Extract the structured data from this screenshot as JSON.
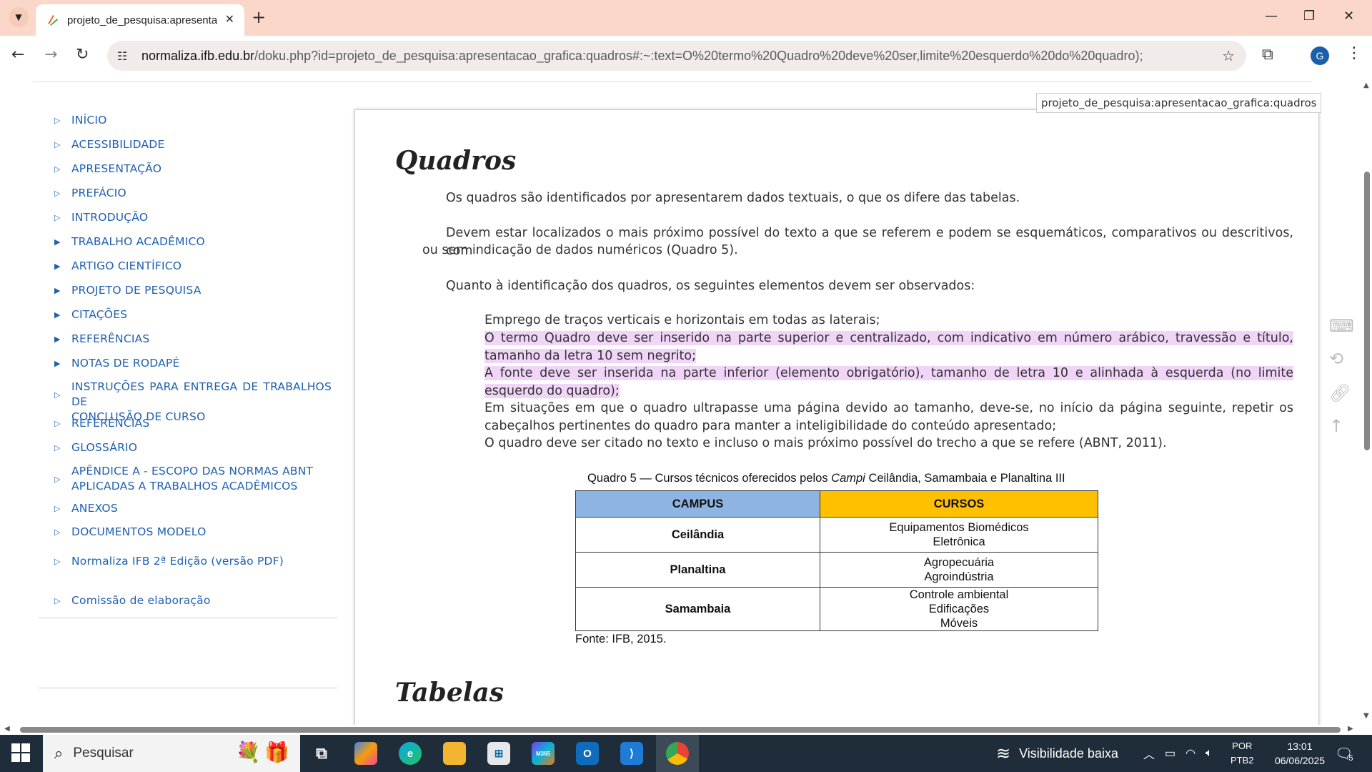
{
  "browser": {
    "tab_title": "projeto_de_pesquisa:apresentac",
    "url_domain": "normaliza.ifb.edu.br",
    "url_path": "/doku.php?id=projeto_de_pesquisa:apresentacao_grafica:quadros#:~:text=O%20termo%20Quadro%20deve%20ser,limite%20esquerdo%20do%20quadro);",
    "profile_initial": "G"
  },
  "sidebar": {
    "items": [
      {
        "label": "INÍCIO",
        "expandable": false
      },
      {
        "label": "ACESSIBILIDADE",
        "expandable": false
      },
      {
        "label": "APRESENTAÇÃO",
        "expandable": false
      },
      {
        "label": "PREFÁCIO",
        "expandable": false
      },
      {
        "label": "INTRODUÇÃO",
        "expandable": false
      },
      {
        "label": "TRABALHO ACADÊMICO",
        "expandable": true
      },
      {
        "label": "ARTIGO CIENTÍFICO",
        "expandable": true
      },
      {
        "label": "PROJETO DE PESQUISA",
        "expandable": true
      },
      {
        "label": "CITAÇÕES",
        "expandable": true
      },
      {
        "label": "REFERÊNCIAS",
        "expandable": true
      },
      {
        "label": "NOTAS DE RODAPÉ",
        "expandable": true
      },
      {
        "label": "INSTRUÇÕES PARA ENTREGA DE TRABALHOS DE",
        "label2": "CONCLUSÃO DE CURSO",
        "expandable": false
      },
      {
        "label": "REFERÊNCIAS",
        "expandable": false
      },
      {
        "label": "GLOSSÁRIO",
        "expandable": false
      },
      {
        "label": "APÊNDICE A - ESCOPO DAS NORMAS ABNT",
        "label2": "APLICADAS A TRABALHOS ACADÊMICOS",
        "expandable": false
      },
      {
        "label": "ANEXOS",
        "expandable": false
      }
    ],
    "items2": [
      {
        "label": "DOCUMENTOS MODELO"
      },
      {
        "label": "Normaliza IFB 2ª Edição (versão PDF)"
      }
    ],
    "items3": [
      {
        "label": "Comissão de elaboração"
      }
    ]
  },
  "content": {
    "pagename": "projeto_de_pesquisa:apresentacao_grafica:quadros",
    "heading": "Quadros",
    "p1": "Os quadros são identificados por apresentarem dados textuais, o que os difere das tabelas.",
    "p2a": "Devem estar localizados o mais próximo possível do texto a que se referem e podem se esquemáticos, comparativos ou descritivos, com",
    "p2b": "ou sem indicação de dados numéricos (Quadro 5).",
    "p3": "Quanto à identificação dos quadros, os seguintes elementos devem ser observados:",
    "list": [
      {
        "text": "Emprego de traços verticais e horizontais em todas as laterais;",
        "highlight": false
      },
      {
        "text": "O termo Quadro deve ser inserido na parte superior e centralizado, com indicativo em número arábico, travessão e título, tamanho da letra 10 sem negrito;",
        "highlight": true
      },
      {
        "text": "A fonte deve ser inserida na parte inferior (elemento obrigatório), tamanho de letra 10 e alinhada à esquerda (no limite esquerdo do quadro);",
        "highlight": true
      },
      {
        "text": "Em situações em que o quadro ultrapasse uma página devido ao tamanho, deve-se, no início da página seguinte, repetir os cabeçalhos pertinentes do quadro para manter a inteligibilidade do conteúdo apresentado;",
        "highlight": false
      },
      {
        "text": "O quadro deve ser citado no texto e incluso o mais próximo possível do trecho a que se refere (ABNT, 2011).",
        "highlight": false
      }
    ],
    "caption_pre": "Quadro 5 — Cursos técnicos oferecidos pelos ",
    "caption_em": "Campi",
    "caption_post": " Ceilândia, Samambaia e Planaltina III",
    "table": {
      "headers": [
        "CAMPUS",
        "CURSOS"
      ],
      "header_colors": [
        "#8eb4e3",
        "#ffc000"
      ],
      "rows": [
        {
          "campus": "Ceilândia",
          "cursos": [
            "Equipamentos Biomédicos",
            "Eletrônica"
          ]
        },
        {
          "campus": "Planaltina",
          "cursos": [
            "Agropecuária",
            "Agroindústria"
          ]
        },
        {
          "campus": "Samambaia",
          "cursos": [
            "Controle ambiental",
            "Edificações",
            "Móveis"
          ]
        }
      ]
    },
    "fonte": "Fonte: IFB, 2015.",
    "heading2": "Tabelas"
  },
  "taskbar": {
    "search_text": "Pesquisar",
    "weather": "Visibilidade baixa",
    "lang1": "POR",
    "lang2": "PTB2",
    "time": "13:01",
    "date": "06/06/2025",
    "notif_count": "5"
  }
}
